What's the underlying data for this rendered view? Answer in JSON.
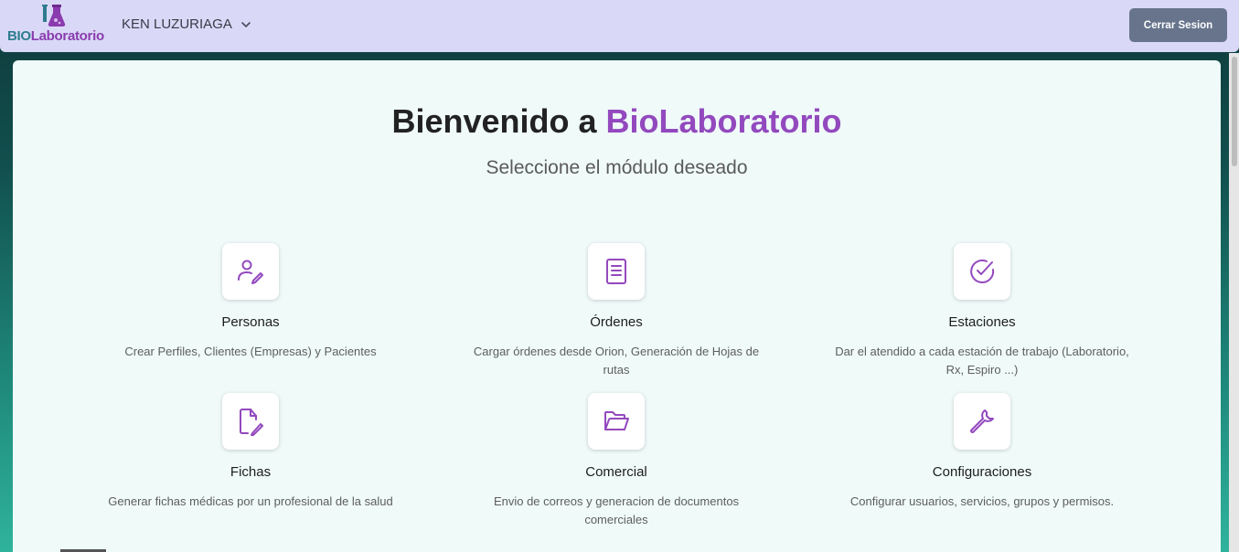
{
  "brand": {
    "bio": "BIO",
    "lab": "Laboratorio"
  },
  "header": {
    "user_name": "KEN LUZURIAGA",
    "logout_label": "Cerrar Sesion"
  },
  "main": {
    "title_prefix": "Bienvenido a",
    "title_brand": "BioLaboratorio",
    "subtitle": "Seleccione el módulo deseado"
  },
  "modules": [
    {
      "title": "Personas",
      "description": "Crear Perfiles, Clientes (Empresas) y Pacientes",
      "icon": "user-edit-icon"
    },
    {
      "title": "Órdenes",
      "description": "Cargar órdenes desde Orion, Generación de Hojas de rutas",
      "icon": "document-icon"
    },
    {
      "title": "Estaciones",
      "description": "Dar el atendido a cada estación de trabajo (Laboratorio, Rx, Espiro ...)",
      "icon": "check-circle-icon"
    },
    {
      "title": "Fichas",
      "description": "Generar fichas médicas por un profesional de la salud",
      "icon": "file-edit-icon"
    },
    {
      "title": "Comercial",
      "description": "Envio de correos y generacion de documentos comerciales",
      "icon": "folder-open-icon"
    },
    {
      "title": "Configuraciones",
      "description": "Configurar usuarios, servicios, grupos y permisos.",
      "icon": "wrench-icon"
    }
  ],
  "colors": {
    "accent": "#9349be",
    "header_bg": "#d9d9f7",
    "button_bg": "#67748c",
    "card_bg": "#effaf9"
  }
}
